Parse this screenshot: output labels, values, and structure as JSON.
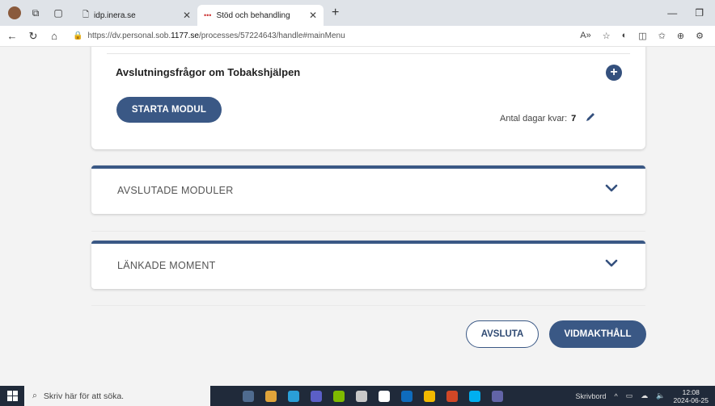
{
  "browser": {
    "tabs": [
      {
        "title": "idp.inera.se",
        "active": false
      },
      {
        "title": "Stöd och behandling",
        "active": true
      }
    ],
    "url_prefix": "https://dv.personal.sob.",
    "url_domain": "1177.se",
    "url_path": "/processes/57224643/handle#mainMenu"
  },
  "module": {
    "title": "Avslutningsfrågor om Tobakshjälpen",
    "start_label": "STARTA MODUL",
    "days_label": "Antal dagar kvar:",
    "days_value": "7"
  },
  "sections": [
    {
      "label": "AVSLUTADE MODULER"
    },
    {
      "label": "LÄNKADE MOMENT"
    }
  ],
  "actions": {
    "avsluta": "AVSLUTA",
    "vidmakthall": "VIDMAKTHÅLL"
  },
  "taskbar": {
    "search_placeholder": "Skriv här för att söka.",
    "desktop_label": "Skrivbord",
    "time": "12:08",
    "date": "2024-06-25"
  },
  "colors": {
    "primary": "#3a5885",
    "background": "#f3f3f3"
  }
}
